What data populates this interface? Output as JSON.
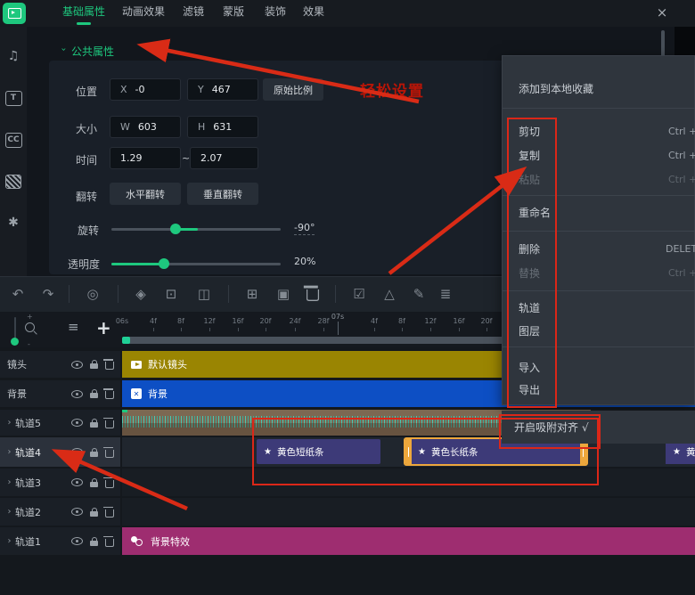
{
  "window": {
    "close_glyph": "×"
  },
  "tabs": [
    {
      "label": "基础属性",
      "active": true
    },
    {
      "label": "动画效果",
      "active": false
    },
    {
      "label": "滤镜",
      "active": false
    },
    {
      "label": "蒙版",
      "active": false
    },
    {
      "label": "装饰",
      "active": false
    },
    {
      "label": "效果",
      "active": false
    }
  ],
  "sidebar": {
    "icons": [
      {
        "name": "media-library-icon",
        "type": "logo"
      },
      {
        "name": "music-icon",
        "glyph": "♫"
      },
      {
        "name": "text-icon",
        "glyph": "T"
      },
      {
        "name": "captions-icon",
        "glyph": "CC"
      },
      {
        "name": "transitions-icon",
        "type": "stripes"
      },
      {
        "name": "effects-icon",
        "glyph": "✱"
      }
    ]
  },
  "properties": {
    "section_title": "公共属性",
    "position": {
      "label": "位置",
      "x_prefix": "X",
      "x_value": "-0",
      "y_prefix": "Y",
      "y_value": "467",
      "ratio_button": "原始比例"
    },
    "size": {
      "label": "大小",
      "w_prefix": "W",
      "w_value": "603",
      "h_prefix": "H",
      "h_value": "631"
    },
    "time": {
      "label": "时间",
      "start": "1.29",
      "separator": "~",
      "end": "2.07"
    },
    "flip": {
      "label": "翻转",
      "horizontal": "水平翻转",
      "vertical": "垂直翻转"
    },
    "rotation": {
      "label": "旋转",
      "value": "-90°"
    },
    "opacity": {
      "label": "透明度",
      "value": "20%"
    }
  },
  "annotations": {
    "easy_setup": "轻松设置"
  },
  "context_menu": {
    "items": [
      {
        "key": "add-to-local-favorites",
        "label": "添加到本地收藏"
      },
      {
        "key": "cut",
        "label": "剪切",
        "shortcut": "Ctrl +"
      },
      {
        "key": "copy",
        "label": "复制",
        "shortcut": "Ctrl +"
      },
      {
        "key": "paste",
        "label": "粘贴",
        "shortcut": "Ctrl +",
        "disabled": true
      },
      {
        "key": "rename",
        "label": "重命名"
      },
      {
        "key": "delete",
        "label": "删除",
        "shortcut": "DELETE"
      },
      {
        "key": "replace",
        "label": "替换",
        "shortcut": "Ctrl +",
        "disabled": true
      },
      {
        "key": "track",
        "label": "轨道"
      },
      {
        "key": "layer",
        "label": "图层"
      },
      {
        "key": "import",
        "label": "导入"
      },
      {
        "key": "export",
        "label": "导出"
      }
    ]
  },
  "snap_toggle": {
    "label": "开启吸附对齐",
    "check": "√"
  },
  "toolbar": {
    "icons": [
      {
        "name": "undo-icon",
        "glyph": "↶"
      },
      {
        "name": "redo-icon",
        "glyph": "↷"
      },
      {
        "name": "record-icon",
        "glyph": "◎"
      },
      {
        "name": "keyframe-icon",
        "glyph": "◈"
      },
      {
        "name": "mark-icon",
        "glyph": "⊡"
      },
      {
        "name": "split-icon",
        "glyph": "◫"
      },
      {
        "name": "crop-icon",
        "glyph": "⊞"
      },
      {
        "name": "copy-clip-icon",
        "glyph": "▣"
      },
      {
        "name": "delete-clip-icon",
        "glyph": "trash"
      },
      {
        "name": "check-icon",
        "glyph": "☑"
      },
      {
        "name": "speed-icon",
        "glyph": "△"
      },
      {
        "name": "edit-icon",
        "glyph": "✎"
      },
      {
        "name": "layers-icon",
        "glyph": "≣"
      }
    ]
  },
  "timeline": {
    "controls": {
      "track_manager_glyph": "≡",
      "add_track_glyph": "+",
      "zoom_plus": "+",
      "zoom_minus": "-"
    },
    "ruler": {
      "start_label": "06s",
      "second_label": "07s",
      "frame_labels_1": [
        "4f",
        "8f",
        "12f",
        "16f",
        "20f",
        "24f",
        "28f"
      ],
      "frame_labels_2": [
        "4f",
        "8f",
        "12f",
        "16f",
        "20f"
      ]
    },
    "tracks": [
      {
        "key": "shots",
        "name": "镜头",
        "expandable": false,
        "selected": false
      },
      {
        "key": "background",
        "name": "背景",
        "expandable": false,
        "selected": false
      },
      {
        "key": "track-5",
        "name": "轨道5",
        "expandable": true,
        "selected": false
      },
      {
        "key": "track-4",
        "name": "轨道4",
        "expandable": true,
        "selected": true
      },
      {
        "key": "track-3",
        "name": "轨道3",
        "expandable": true,
        "selected": false
      },
      {
        "key": "track-2",
        "name": "轨道2",
        "expandable": true,
        "selected": false
      },
      {
        "key": "track-1",
        "name": "轨道1",
        "expandable": true,
        "selected": false
      }
    ],
    "clips": {
      "intro": {
        "label": "默认镜头",
        "color": "#9a8502"
      },
      "background": {
        "label": "背景",
        "color": "#0d4fc4"
      },
      "audio": {
        "color": "#7c6852"
      },
      "strip_short": {
        "label": "黄色短纸条",
        "color": "#3d3a78"
      },
      "strip_long": {
        "label": "黄色长纸条",
        "color": "#3d3a78",
        "selected": true
      },
      "strip_partial": {
        "label": "黄色短纸条",
        "color": "#3d3a78"
      },
      "bg_effect": {
        "label": "背景特效",
        "color": "#9e2d70"
      }
    }
  },
  "colors": {
    "accent_green": "#1ec87e",
    "annotation_red": "#db2718",
    "selection_orange": "#eda73c",
    "clip_yellow": "#9a8502",
    "clip_blue": "#0d4fc4",
    "clip_purple": "#3d3a78",
    "clip_magenta": "#9e2d70",
    "audio_tan": "#7c6852"
  }
}
